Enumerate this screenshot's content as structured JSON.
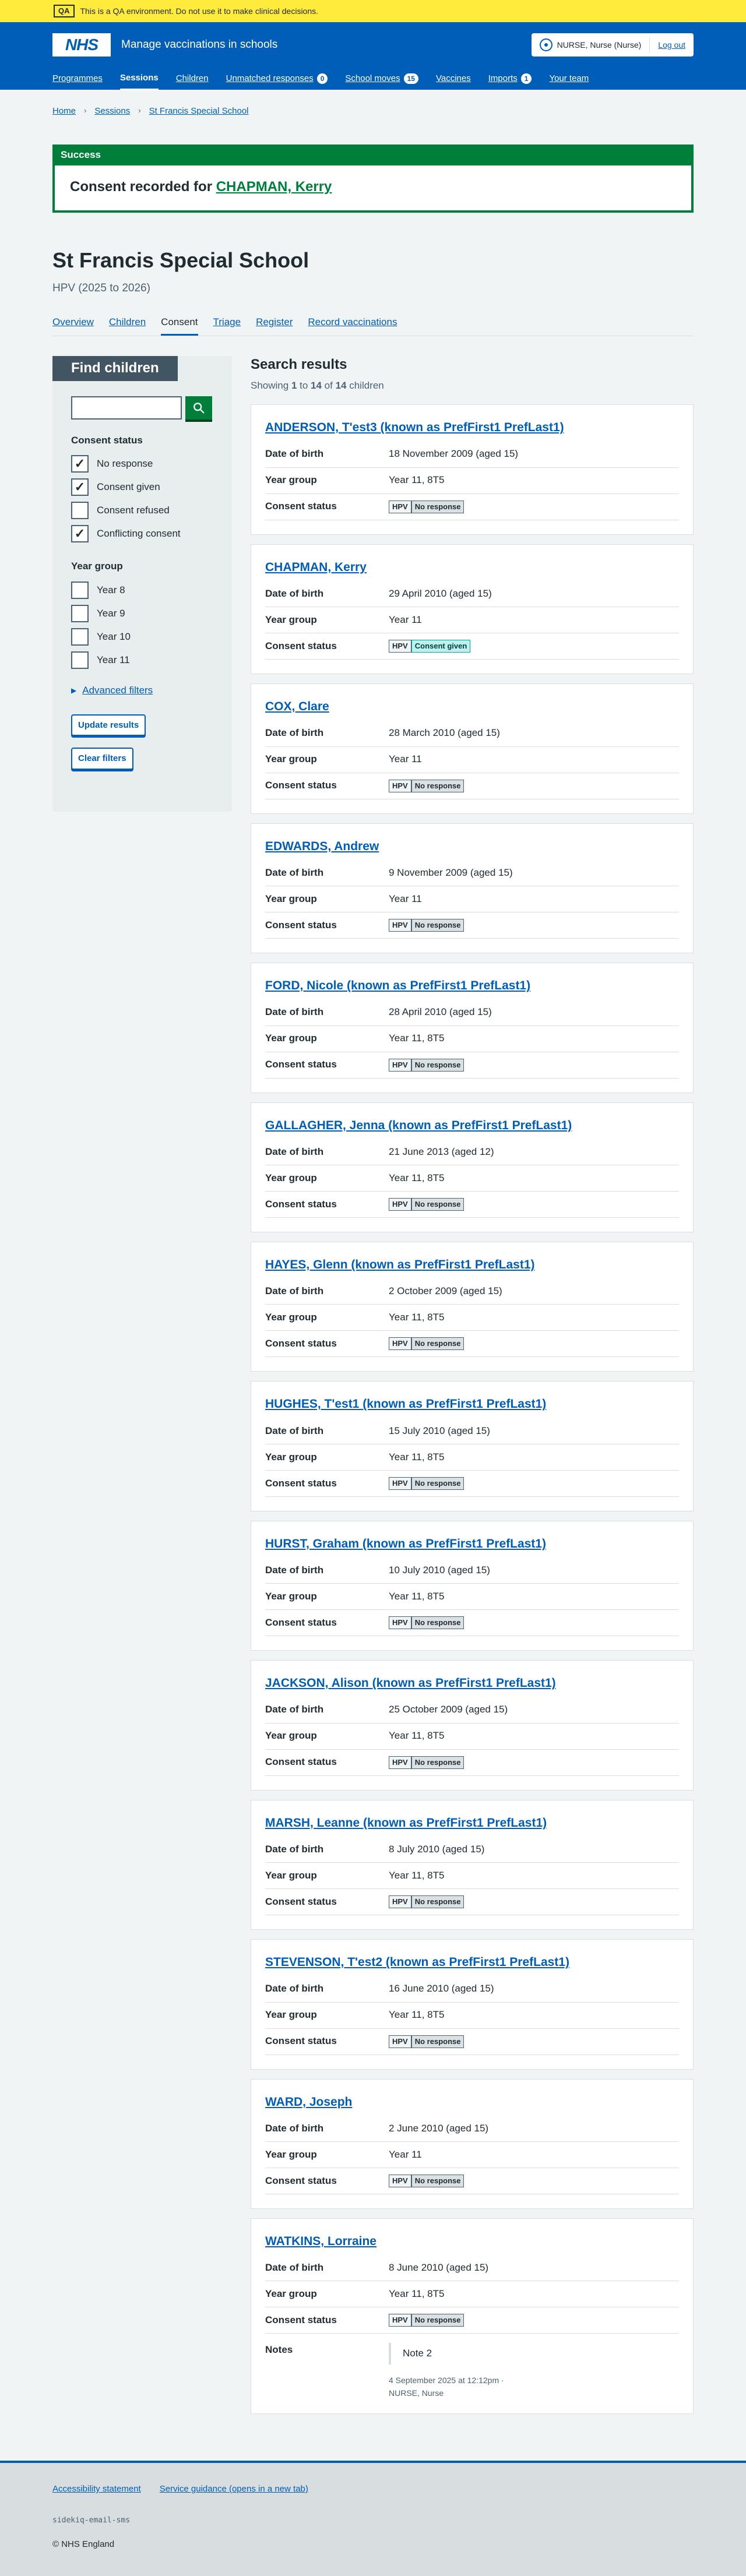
{
  "qa": {
    "tag": "QA",
    "message": "This is a QA environment. Do not use it to make clinical decisions."
  },
  "header": {
    "logo": "NHS",
    "service_name": "Manage vaccinations in schools",
    "account_name": "NURSE, Nurse (Nurse)",
    "logout": "Log out",
    "nav": [
      {
        "label": "Programmes"
      },
      {
        "label": "Sessions",
        "current": true
      },
      {
        "label": "Children"
      },
      {
        "label": "Unmatched responses",
        "count": "0"
      },
      {
        "label": "School moves",
        "count": "15"
      },
      {
        "label": "Vaccines"
      },
      {
        "label": "Imports",
        "count": "1"
      },
      {
        "label": "Your team"
      }
    ]
  },
  "breadcrumb": [
    "Home",
    "Sessions",
    "St Francis Special School"
  ],
  "success": {
    "heading": "Success",
    "text": "Consent recorded for ",
    "link": "CHAPMAN, Kerry"
  },
  "page": {
    "title": "St Francis Special School",
    "caption": "HPV (2025 to 2026)"
  },
  "subnav": [
    "Overview",
    "Children",
    "Consent",
    "Triage",
    "Register",
    "Record vaccinations"
  ],
  "filters": {
    "heading": "Find children",
    "search_value": "",
    "consent_legend": "Consent status",
    "consent_options": [
      {
        "label": "No response",
        "checked": true
      },
      {
        "label": "Consent given",
        "checked": true
      },
      {
        "label": "Consent refused",
        "checked": false
      },
      {
        "label": "Conflicting consent",
        "checked": true
      }
    ],
    "year_legend": "Year group",
    "year_options": [
      {
        "label": "Year 8",
        "checked": false
      },
      {
        "label": "Year 9",
        "checked": false
      },
      {
        "label": "Year 10",
        "checked": false
      },
      {
        "label": "Year 11",
        "checked": false
      }
    ],
    "advanced": "Advanced filters",
    "update": "Update results",
    "clear": "Clear filters"
  },
  "results": {
    "title": "Search results",
    "summary_pre": "Showing ",
    "from": "1",
    "to_word": " to ",
    "to": "14",
    "of_word": " of ",
    "total": "14",
    "summary_post": " children",
    "labels": {
      "dob": "Date of birth",
      "year": "Year group",
      "consent": "Consent status",
      "notes": "Notes"
    },
    "programme_tag": "HPV",
    "children": [
      {
        "name": "ANDERSON, T'est3 (known as PrefFirst1 PrefLast1)",
        "dob": "18 November 2009 (aged 15)",
        "year": "Year 11, 8T5",
        "status": "No response",
        "status_style": "grey"
      },
      {
        "name": "CHAPMAN, Kerry",
        "dob": "29 April 2010 (aged 15)",
        "year": "Year 11",
        "status": "Consent given",
        "status_style": "aqua"
      },
      {
        "name": "COX, Clare",
        "dob": "28 March 2010 (aged 15)",
        "year": "Year 11",
        "status": "No response",
        "status_style": "grey"
      },
      {
        "name": "EDWARDS, Andrew",
        "dob": "9 November 2009 (aged 15)",
        "year": "Year 11",
        "status": "No response",
        "status_style": "grey"
      },
      {
        "name": "FORD, Nicole (known as PrefFirst1 PrefLast1)",
        "dob": "28 April 2010 (aged 15)",
        "year": "Year 11, 8T5",
        "status": "No response",
        "status_style": "grey"
      },
      {
        "name": "GALLAGHER, Jenna (known as PrefFirst1 PrefLast1)",
        "dob": "21 June 2013 (aged 12)",
        "year": "Year 11, 8T5",
        "status": "No response",
        "status_style": "grey"
      },
      {
        "name": "HAYES, Glenn (known as PrefFirst1 PrefLast1)",
        "dob": "2 October 2009 (aged 15)",
        "year": "Year 11, 8T5",
        "status": "No response",
        "status_style": "grey"
      },
      {
        "name": "HUGHES, T'est1 (known as PrefFirst1 PrefLast1)",
        "dob": "15 July 2010 (aged 15)",
        "year": "Year 11, 8T5",
        "status": "No response",
        "status_style": "grey"
      },
      {
        "name": "HURST, Graham (known as PrefFirst1 PrefLast1)",
        "dob": "10 July 2010 (aged 15)",
        "year": "Year 11, 8T5",
        "status": "No response",
        "status_style": "grey"
      },
      {
        "name": "JACKSON, Alison (known as PrefFirst1 PrefLast1)",
        "dob": "25 October 2009 (aged 15)",
        "year": "Year 11, 8T5",
        "status": "No response",
        "status_style": "grey"
      },
      {
        "name": "MARSH, Leanne (known as PrefFirst1 PrefLast1)",
        "dob": "8 July 2010 (aged 15)",
        "year": "Year 11, 8T5",
        "status": "No response",
        "status_style": "grey"
      },
      {
        "name": "STEVENSON, T'est2 (known as PrefFirst1 PrefLast1)",
        "dob": "16 June 2010 (aged 15)",
        "year": "Year 11, 8T5",
        "status": "No response",
        "status_style": "grey"
      },
      {
        "name": "WARD, Joseph",
        "dob": "2 June 2010 (aged 15)",
        "year": "Year 11",
        "status": "No response",
        "status_style": "grey"
      },
      {
        "name": "WATKINS, Lorraine",
        "dob": "8 June 2010 (aged 15)",
        "year": "Year 11, 8T5",
        "status": "No response",
        "status_style": "grey",
        "note": {
          "text": "Note 2",
          "meta": "4 September 2025 at 12:12pm · NURSE, Nurse"
        }
      }
    ]
  },
  "footer": {
    "links": [
      "Accessibility statement",
      "Service guidance (opens in a new tab)"
    ],
    "code": "sidekiq-email-sms",
    "copyright": "© NHS England"
  },
  "colors": {
    "nhs_blue": "#005eb8",
    "success_green": "#007f3b",
    "qa_yellow": "#ffeb3b"
  }
}
